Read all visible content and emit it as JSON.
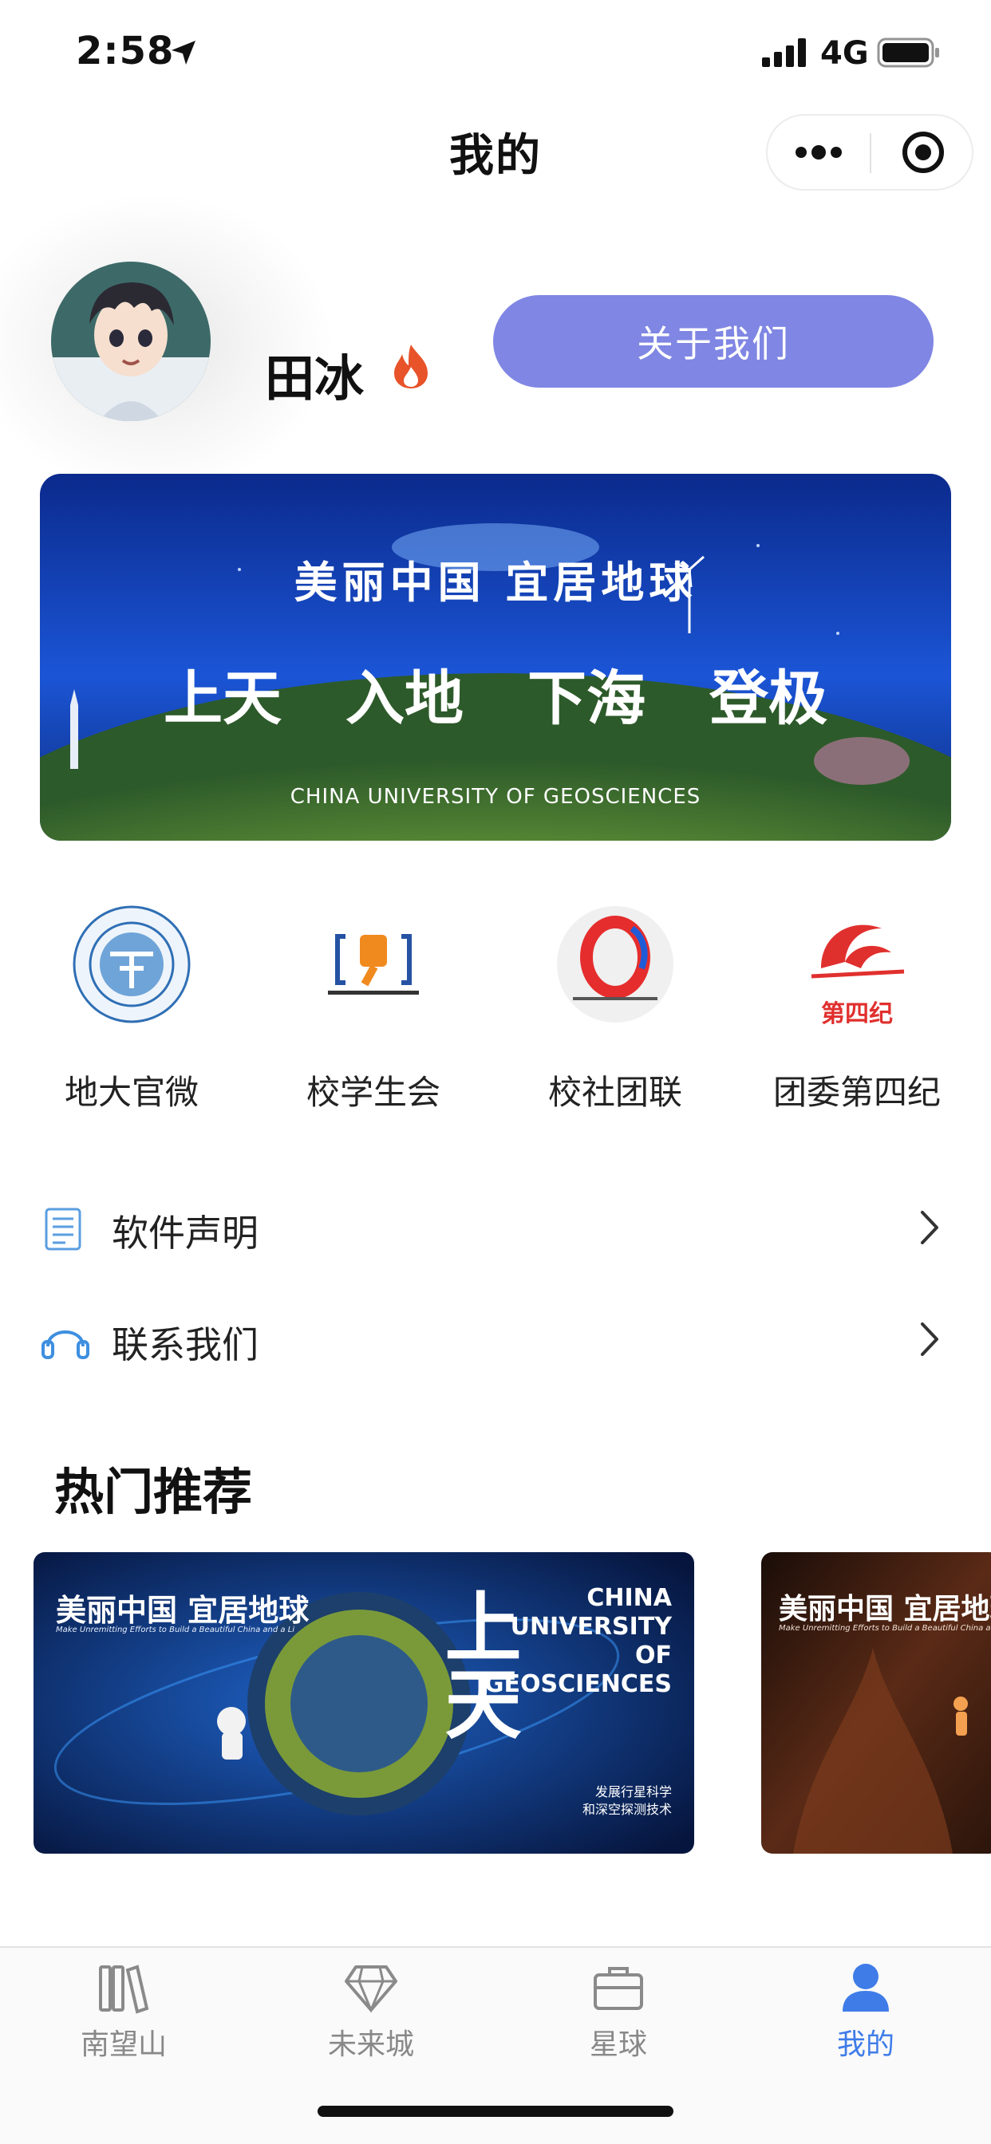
{
  "status_bar": {
    "time": "2:58",
    "network": "4G",
    "icons": [
      "location-arrow-icon",
      "signal-icon",
      "battery-icon"
    ]
  },
  "nav": {
    "title": "我的",
    "more_icon": "more-dots-icon",
    "close_icon": "target-close-icon"
  },
  "profile": {
    "name": "田冰",
    "badge_icon": "fire-icon",
    "about_button": "关于我们"
  },
  "banner": {
    "title": "美丽中国 宜居地球",
    "slogan": [
      "上天",
      "入地",
      "下海",
      "登极"
    ],
    "caption": "CHINA UNIVERSITY OF GEOSCIENCES"
  },
  "quick_links": [
    {
      "label": "地大官微",
      "icon": "cug-seal-logo"
    },
    {
      "label": "校学生会",
      "icon": "student-union-logo"
    },
    {
      "label": "校社团联",
      "icon": "club-federation-logo"
    },
    {
      "label": "团委第四纪",
      "icon": "quaternary-logo",
      "logo_text": "第四纪"
    }
  ],
  "menu": [
    {
      "label": "软件声明",
      "icon": "document-icon"
    },
    {
      "label": "联系我们",
      "icon": "headset-icon"
    }
  ],
  "section": {
    "title": "热门推荐"
  },
  "recommendations": [
    {
      "title": "美丽中国  宜居地球",
      "subtitle": "Make Unremitting Efforts to Build a Beautiful China and a Livable Earth",
      "university": [
        "CHINA",
        "UNIVERSITY OF",
        "GEOSCIENCES"
      ],
      "big_text": "上天",
      "caption": [
        "发展行星科学",
        "和深空探测技术"
      ]
    },
    {
      "title": "美丽中国  宜居地球",
      "subtitle": "Make Unremitting Efforts to Build a Beautiful China and a Livable Earth"
    }
  ],
  "tab_bar": {
    "tabs": [
      {
        "label": "南望山",
        "icon": "books-icon",
        "active": false
      },
      {
        "label": "未来城",
        "icon": "diamond-icon",
        "active": false
      },
      {
        "label": "星球",
        "icon": "briefcase-icon",
        "active": false
      },
      {
        "label": "我的",
        "icon": "person-icon",
        "active": true
      }
    ],
    "active_color": "#3f7ce8",
    "inactive_color": "#888888"
  },
  "colors": {
    "accent_button": "#7f86e3",
    "fire": "#e8532a"
  }
}
